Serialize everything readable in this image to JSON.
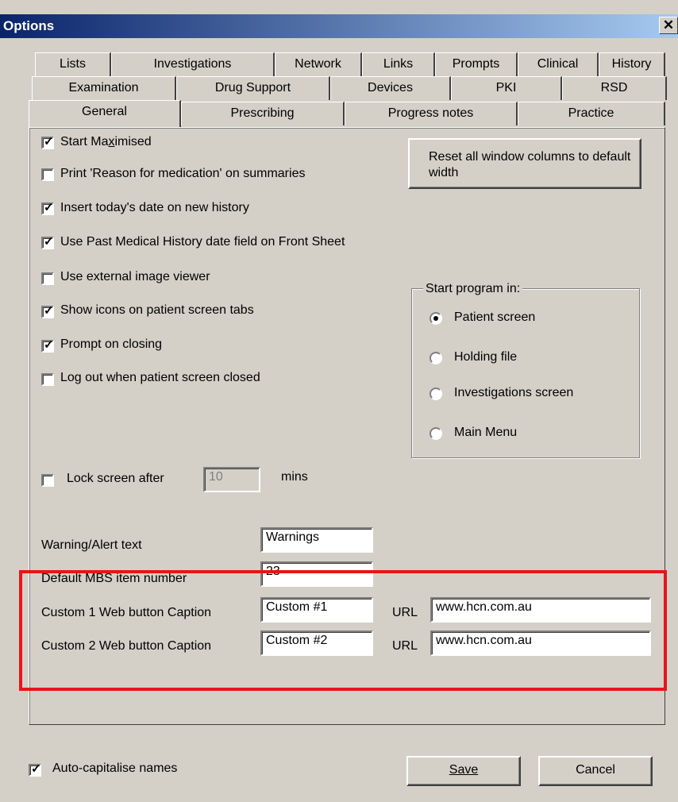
{
  "window": {
    "title": "Options",
    "close_glyph": "✕"
  },
  "tabs": {
    "row1": [
      "Lists",
      "Investigations",
      "Network",
      "Links",
      "Prompts",
      "Clinical",
      "History"
    ],
    "row2": [
      "Examination",
      "Drug Support",
      "Devices",
      "PKI",
      "RSD"
    ],
    "row3": [
      "General",
      "Prescribing",
      "Progress notes",
      "Practice"
    ],
    "active": "General"
  },
  "general": {
    "checkboxes": [
      {
        "label": "Start Maximised",
        "checked": true
      },
      {
        "label": "Print 'Reason for medication' on summaries",
        "checked": false
      },
      {
        "label": "Insert today's date on new history",
        "checked": true
      },
      {
        "label": "Use Past Medical History date field on Front Sheet",
        "checked": true
      },
      {
        "label": "Use external image viewer",
        "checked": false
      },
      {
        "label": "Show icons on patient screen tabs",
        "checked": true
      },
      {
        "label": "Prompt on closing",
        "checked": true
      },
      {
        "label": "Log out when patient screen closed",
        "checked": false
      }
    ],
    "reset_button": "Reset all window columns to default width",
    "start_program": {
      "legend": "Start program in:",
      "options": [
        "Patient screen",
        "Holding file",
        "Investigations screen",
        "Main Menu"
      ],
      "selected": "Patient screen"
    },
    "lock_screen": {
      "label": "Lock screen after",
      "checked": false,
      "value": "10",
      "unit": "mins"
    },
    "warning_alert": {
      "label": "Warning/Alert text",
      "value": "Warnings"
    },
    "default_mbs": {
      "label": "Default MBS item number",
      "value": "23"
    },
    "custom1": {
      "label": "Custom 1 Web button Caption",
      "caption": "Custom #1",
      "url_label": "URL",
      "url": "www.hcn.com.au"
    },
    "custom2": {
      "label": "Custom 2 Web button Caption",
      "caption": "Custom #2",
      "url_label": "URL",
      "url": "www.hcn.com.au"
    }
  },
  "footer": {
    "auto_capitalise": {
      "label": "Auto-capitalise names",
      "checked": true
    },
    "save": "Save",
    "cancel": "Cancel"
  },
  "highlight_color": "#e8141b"
}
